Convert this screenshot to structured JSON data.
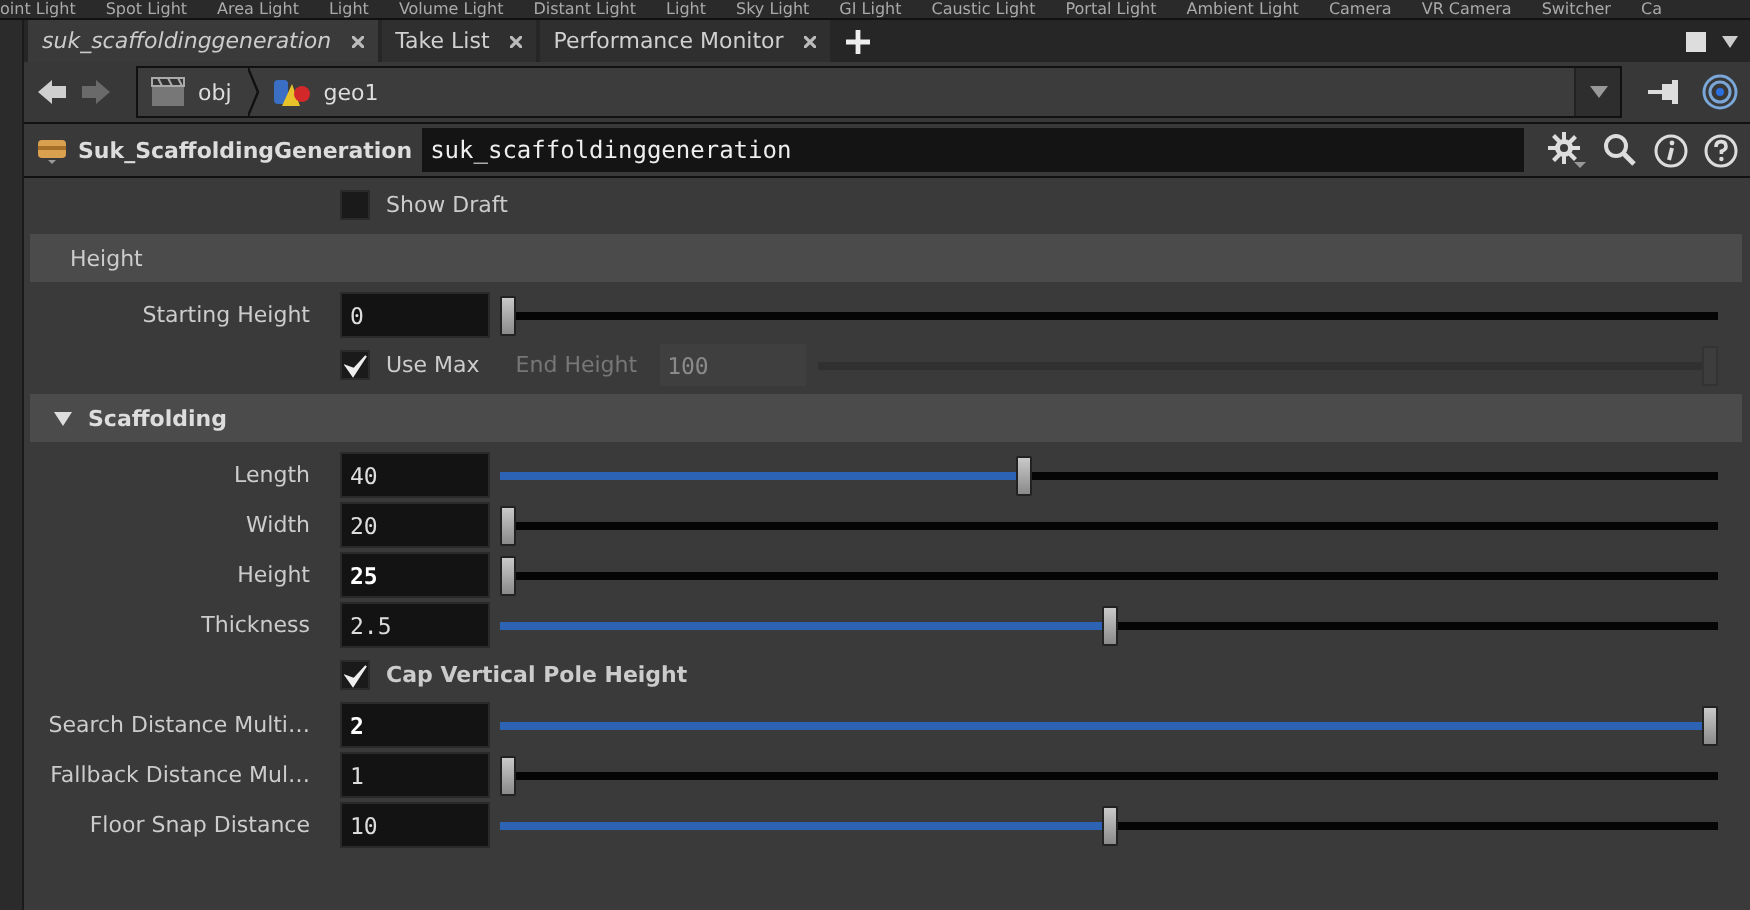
{
  "shelf": {
    "labels": [
      "oint Light",
      "Spot Light",
      "Area Light",
      "Light",
      "Volume Light",
      "Distant Light",
      "Light",
      "Sky Light",
      "GI Light",
      "Caustic Light",
      "Portal Light",
      "Ambient Light",
      "Camera",
      "VR Camera",
      "Switcher",
      "Ca"
    ]
  },
  "tabs": [
    {
      "label": "suk_scaffoldinggeneration",
      "selected": true
    },
    {
      "label": "Take List",
      "selected": false
    },
    {
      "label": "Performance Monitor",
      "selected": false
    }
  ],
  "path": [
    {
      "label": "obj",
      "kind": "network"
    },
    {
      "label": "geo1",
      "kind": "geometry"
    }
  ],
  "node": {
    "type_label": "Suk_ScaffoldingGeneration",
    "name": "suk_scaffoldinggeneration"
  },
  "top_params": [
    {
      "kind": "toggle",
      "label": "Show Draft",
      "checked": false,
      "bold": false
    }
  ],
  "folders": [
    {
      "title": "Height",
      "kind": "simple",
      "params": [
        {
          "kind": "slider",
          "label": "Starting Height",
          "value": "0",
          "bold": false,
          "level": 0
        },
        {
          "kind": "toggle_slider",
          "label": "Use Max",
          "checked": true,
          "bold": false,
          "field": {
            "label": "End Height",
            "value": "100",
            "disabled": true,
            "level": 1
          }
        }
      ]
    },
    {
      "title": "Scaffolding",
      "kind": "collapsible",
      "expanded": true,
      "params": [
        {
          "kind": "slider",
          "label": "Length",
          "value": "40",
          "bold": false,
          "level": 0.43
        },
        {
          "kind": "slider",
          "label": "Width",
          "value": "20",
          "bold": false,
          "level": 0
        },
        {
          "kind": "slider",
          "label": "Height",
          "value": "25",
          "bold": true,
          "level": 0
        },
        {
          "kind": "slider",
          "label": "Thickness",
          "value": "2.5",
          "bold": false,
          "level": 0.5
        },
        {
          "kind": "toggle",
          "label": "Cap Vertical Pole Height",
          "checked": true,
          "bold": true
        },
        {
          "kind": "slider",
          "label": "Search Distance Multi…",
          "value": "2",
          "bold": true,
          "level": 1
        },
        {
          "kind": "slider",
          "label": "Fallback Distance Mul…",
          "value": "1",
          "bold": false,
          "level": 0
        },
        {
          "kind": "slider",
          "label": "Floor Snap Distance",
          "value": "10",
          "bold": false,
          "level": 0.5
        }
      ]
    }
  ]
}
